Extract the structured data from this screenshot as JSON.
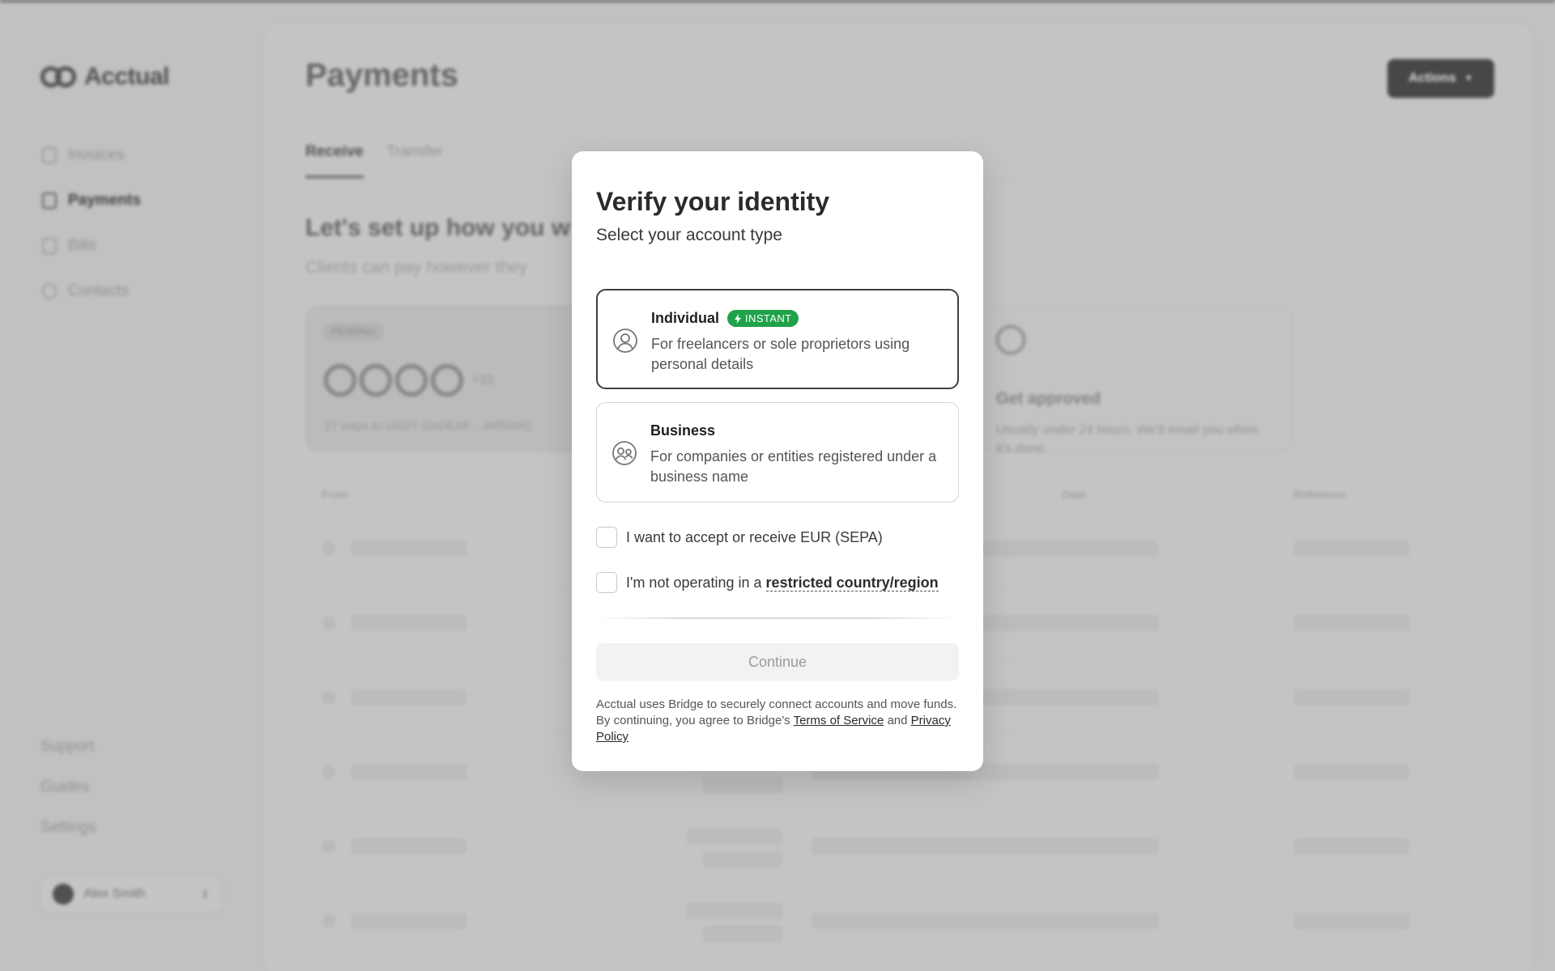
{
  "app": {
    "brand": "Acctual"
  },
  "sidebar": {
    "items": [
      {
        "label": "Invoices",
        "active": false
      },
      {
        "label": "Payments",
        "active": true
      },
      {
        "label": "Bills",
        "active": false
      },
      {
        "label": "Contacts",
        "active": false
      }
    ],
    "bottom": [
      "Support",
      "Guides",
      "Settings"
    ],
    "user": {
      "name": "Alex Smith"
    }
  },
  "main": {
    "title": "Payments",
    "actions_label": "Actions",
    "tabs": [
      {
        "label": "Receive",
        "active": true
      },
      {
        "label": "Transfer",
        "active": false
      }
    ],
    "setup_title": "Let's set up how you w",
    "setup_subtitle": "Clients can pay however they",
    "pending_card": {
      "badge": "PENDING",
      "coins_more": "+10",
      "text": "17 ways to USDT (0xDEAF…d4f5005)"
    },
    "approved_card": {
      "title": "Get approved",
      "text": "Usually under 24 hours. We'll email you when it's done."
    },
    "table_headers": [
      "From",
      "Date",
      "Reference"
    ]
  },
  "modal": {
    "title": "Verify your identity",
    "subtitle": "Select your account type",
    "options": [
      {
        "title": "Individual",
        "badge": "INSTANT",
        "description": "For freelancers or sole proprietors using personal details",
        "selected": true,
        "icon": "user-circle-icon"
      },
      {
        "title": "Business",
        "description": "For companies or entities registered under a business name",
        "selected": false,
        "icon": "users-circle-icon"
      }
    ],
    "checkboxes": {
      "sepa": {
        "label": "I want to accept or receive EUR (SEPA)",
        "checked": false
      },
      "restricted": {
        "prefix": "I'm not operating in a ",
        "link": "restricted country/region",
        "checked": false
      }
    },
    "continue_label": "Continue",
    "legal": {
      "text": "Acctual uses Bridge to securely connect accounts and move funds. By continuing, you agree to Bridge's ",
      "terms": "Terms of Service",
      "and": " and ",
      "privacy": "Privacy Policy"
    }
  },
  "colors": {
    "badge_green": "#1fa24a",
    "selected_border": "#3f3f3f",
    "overlay": "#c9c9c9"
  }
}
